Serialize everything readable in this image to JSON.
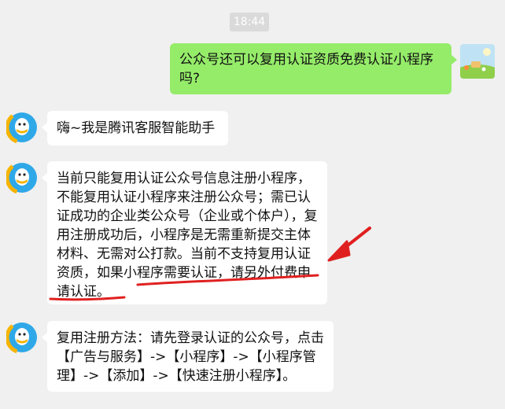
{
  "timestamp": "18:44",
  "messages": [
    {
      "sender": "user",
      "text": "公众号还可以复用认证资质免费认证小程序吗?"
    },
    {
      "sender": "bot",
      "text": "嗨~我是腾讯客服智能助手"
    },
    {
      "sender": "bot",
      "text": "当前只能复用认证公众号信息注册小程序，不能复用认证小程序来注册公众号；需已认证成功的企业类公众号（企业或个体户），复用注册成功后，小程序是无需重新提交主体材料、无需对公打款。当前不支持复用认证资质，如果小程序需要认证，请另外付费申请认证。"
    },
    {
      "sender": "bot",
      "text": "复用注册方法：请先登录认证的公众号，点击【广告与服务】->【小程序】->【小程序管理】->【添加】->【快速注册小程序】。"
    }
  ],
  "colors": {
    "annotation": "#e02020",
    "user_bubble": "#95ec69",
    "background": "#f0f0f0"
  },
  "icons": {
    "bot_avatar": "tencent-qq-icon",
    "user_avatar": "landscape-photo-avatar"
  }
}
